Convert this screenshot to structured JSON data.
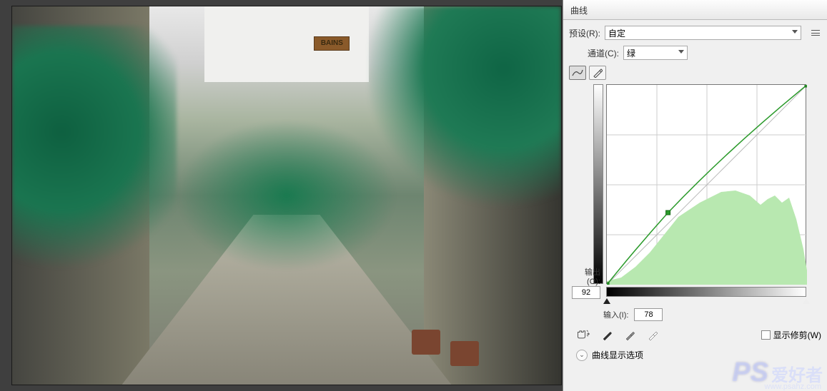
{
  "panel": {
    "title": "曲线",
    "preset_label": "预设(R):",
    "preset_value": "自定",
    "channel_label": "通道(C):",
    "channel_value": "绿",
    "output_label": "输出(O):",
    "output_value": "92",
    "input_label": "输入(I):",
    "input_value": "78",
    "show_clipping_label": "显示修剪(W)",
    "display_options_label": "曲线显示选项"
  },
  "image": {
    "sign_text": "BAINS"
  },
  "watermark": {
    "logo": "PS",
    "cn": "爱好者",
    "url": "www.psahz.com"
  },
  "chart_data": {
    "type": "curve",
    "title": "曲线",
    "channel": "绿",
    "xlabel": "输入",
    "ylabel": "输出",
    "xlim": [
      0,
      255
    ],
    "ylim": [
      0,
      255
    ],
    "points": [
      {
        "input": 0,
        "output": 0
      },
      {
        "input": 78,
        "output": 92
      },
      {
        "input": 255,
        "output": 255
      }
    ],
    "histogram_peak_approx": 180
  }
}
